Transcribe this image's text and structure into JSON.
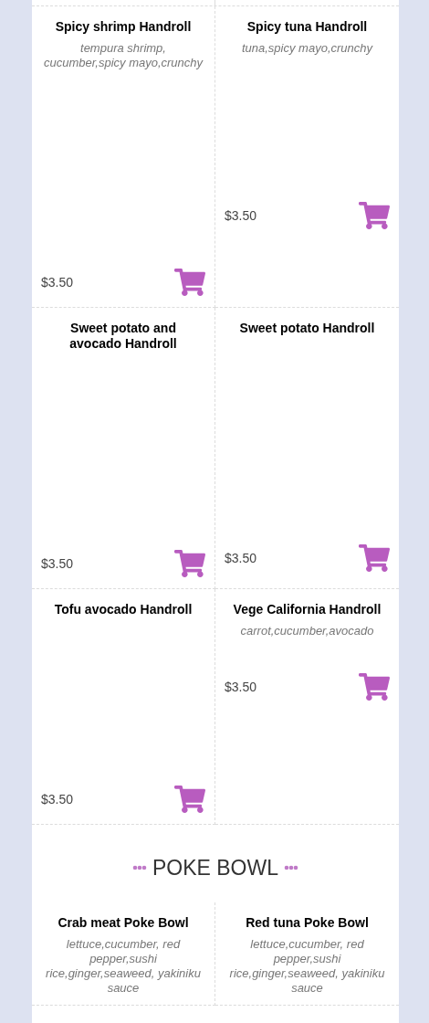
{
  "sections": [
    {
      "items": [
        {
          "name": "Spicy shrimp Handroll",
          "description": "tempura shrimp, cucumber,spicy mayo,crunchy",
          "price": "$3.50"
        },
        {
          "name": "Spicy tuna Handroll",
          "description": "tuna,spicy mayo,crunchy",
          "price": "$3.50"
        },
        {
          "name": "Sweet potato and avocado Handroll",
          "price": "$3.50"
        },
        {
          "name": "Sweet potato Handroll",
          "price": "$3.50"
        },
        {
          "name": "Tofu avocado Handroll",
          "price": "$3.50"
        },
        {
          "name": "Vege California Handroll",
          "description": "carrot,cucumber,avocado",
          "price": "$3.50"
        }
      ]
    },
    {
      "title": "POKE BOWL",
      "items": [
        {
          "name": "Crab meat Poke Bowl",
          "description": "lettuce,cucumber, red pepper,sushi rice,ginger,seaweed, yakiniku sauce"
        },
        {
          "name": "Red tuna Poke Bowl",
          "description": "lettuce,cucumber, red pepper,sushi rice,ginger,seaweed, yakiniku sauce"
        }
      ]
    }
  ]
}
